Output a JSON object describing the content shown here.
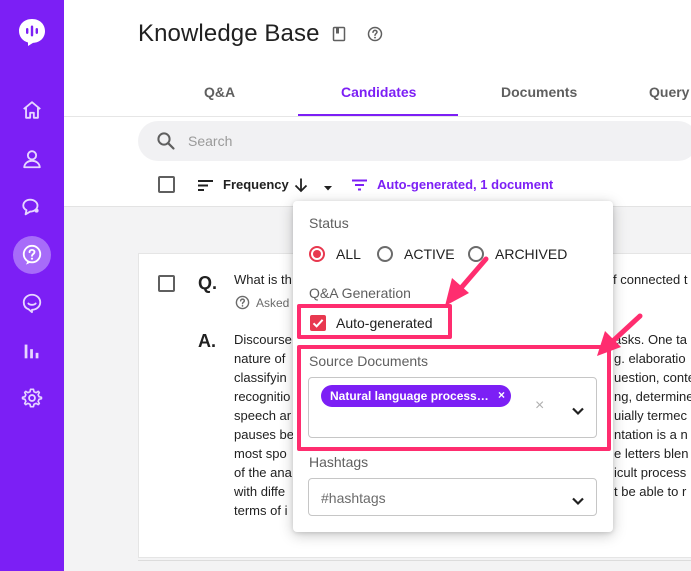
{
  "header": {
    "title": "Knowledge Base"
  },
  "icons": {
    "logo": "chat-bubble-icon",
    "sidebar": [
      "home-icon",
      "user-icon",
      "conversations-icon",
      "knowledge-base-icon",
      "messages-icon",
      "analytics-icon",
      "gear-icon"
    ],
    "book": "book-icon",
    "help": "help-circle-icon"
  },
  "tabs": [
    {
      "label": "Q&A",
      "active": false
    },
    {
      "label": "Candidates",
      "active": true
    },
    {
      "label": "Documents",
      "active": false
    },
    {
      "label": "Query",
      "active": false
    }
  ],
  "search": {
    "placeholder": "Search"
  },
  "toolbar": {
    "sort_label": "Frequency",
    "filter_label": "Auto-generated, 1 document"
  },
  "card": {
    "q_marker": "Q.",
    "a_marker": "A.",
    "question_left": "What is th",
    "question_right": "f connected t",
    "asked_label": "Asked",
    "answer_left": [
      "Discourse",
      "nature of",
      "classifyin",
      "recognitio",
      "speech ar",
      "pauses be",
      "most spo",
      "of the ana",
      "with diffe",
      "terms of i"
    ],
    "answer_right": [
      "asks. One ta",
      "g. elaboratio",
      "uestion, conte",
      "ng, determine",
      "uially termec",
      "ntation is a n",
      "e letters blen",
      "icult process",
      "t be able to r",
      ""
    ]
  },
  "popup": {
    "status_title": "Status",
    "status_options": [
      "ALL",
      "ACTIVE",
      "ARCHIVED"
    ],
    "status_selected": "ALL",
    "generation_title": "Q&A Generation",
    "auto_generated_label": "Auto-generated",
    "auto_generated_checked": true,
    "source_title": "Source Documents",
    "source_chip": "Natural language processi…",
    "chip_remove": "×",
    "clear_symbol": "×",
    "hashtags_title": "Hashtags",
    "hashtags_placeholder": "#hashtags"
  },
  "colors": {
    "brand": "#7c1ff5",
    "accent_red": "#e8384f",
    "annotation": "#ff2d6f"
  }
}
